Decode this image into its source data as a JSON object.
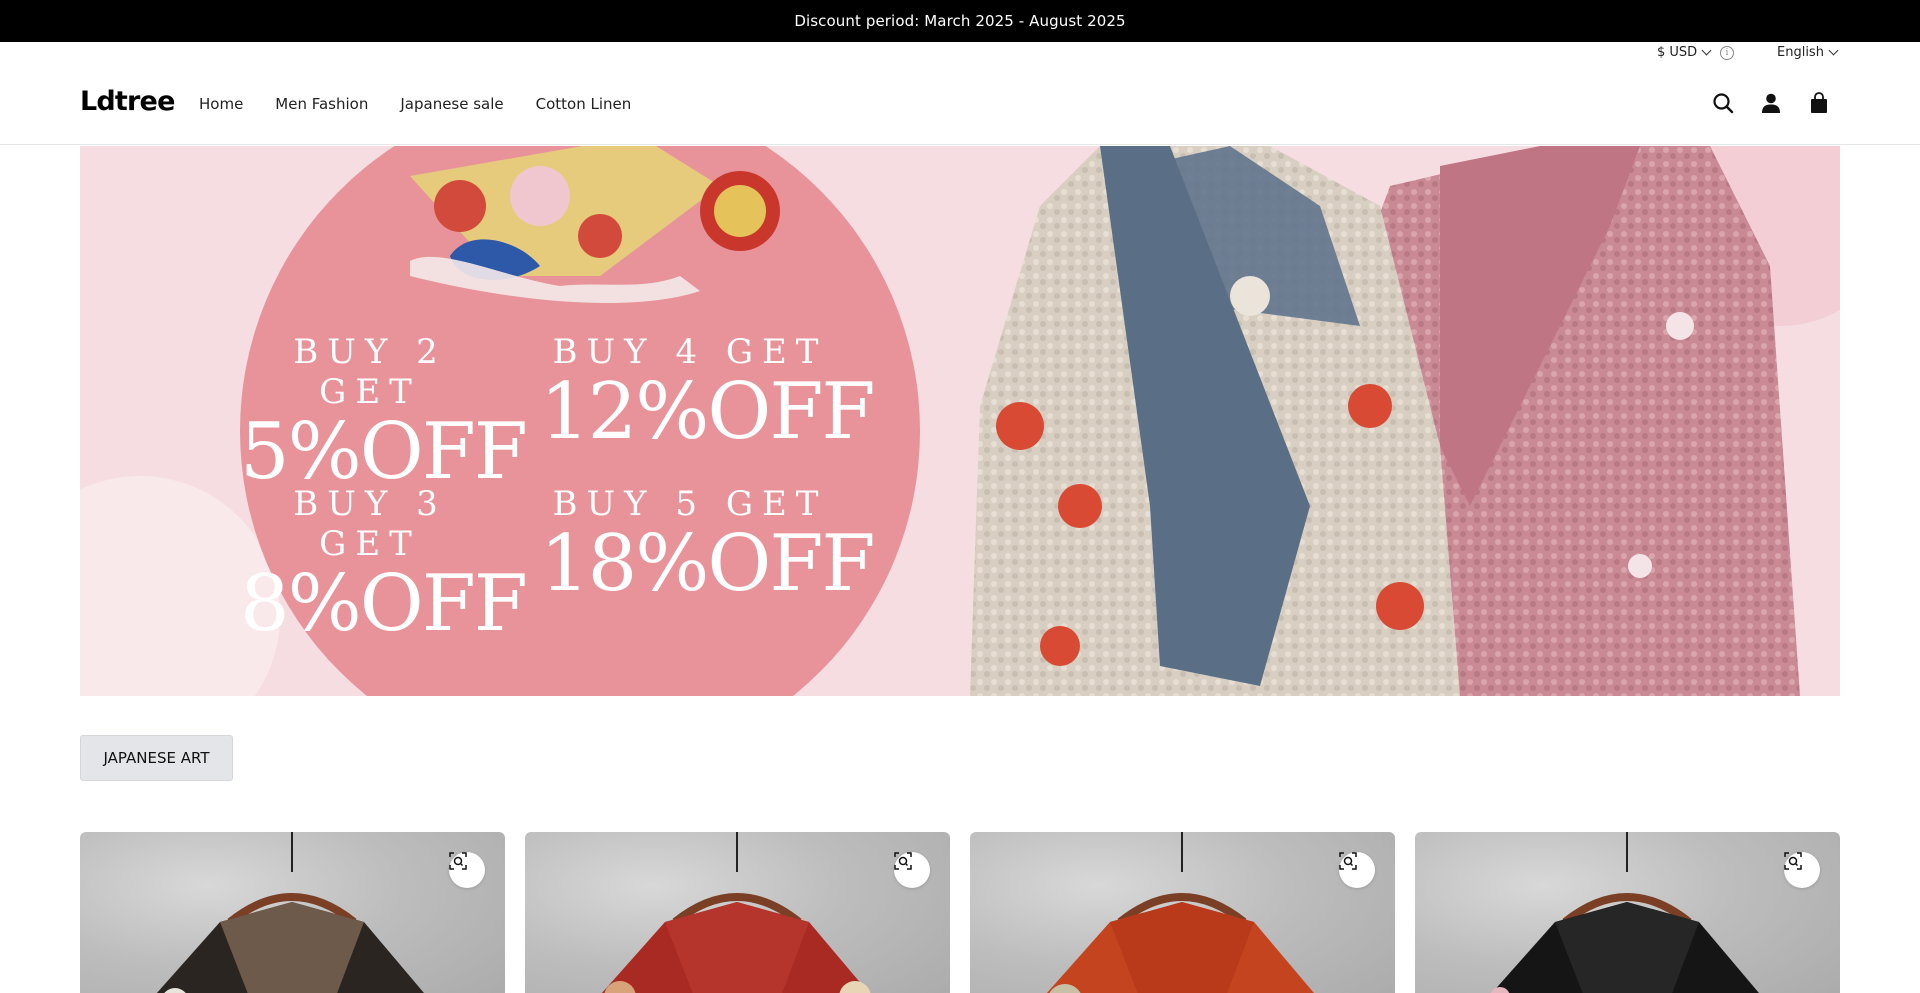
{
  "announcement": "Discount period: March 2025 - August 2025",
  "utility": {
    "currency": "$ USD",
    "language": "English"
  },
  "header": {
    "logo": "Ldtree",
    "nav": [
      "Home",
      "Men Fashion",
      "Japanese sale",
      "Cotton Linen"
    ],
    "icons": [
      "search-icon",
      "account-icon",
      "cart-icon"
    ]
  },
  "hero": {
    "offers": [
      {
        "buy": "BUY 2 GET",
        "off": "5%OFF"
      },
      {
        "buy": "BUY 4 GET",
        "off": "12%OFF"
      },
      {
        "buy": "BUY 3 GET",
        "off": "8%OFF"
      },
      {
        "buy": "BUY 5 GET",
        "off": "18%OFF"
      }
    ]
  },
  "filter": {
    "label": "JAPANESE ART"
  },
  "products": [
    {
      "quick_view_icon": "quick-view-icon",
      "color": "#3a2f2a"
    },
    {
      "quick_view_icon": "quick-view-icon",
      "color": "#a82a22"
    },
    {
      "quick_view_icon": "quick-view-icon",
      "color": "#c4441f"
    },
    {
      "quick_view_icon": "quick-view-icon",
      "color": "#151515"
    }
  ],
  "colors": {
    "announce_bg": "#000000",
    "promo_circle": "#e8939a",
    "button_bg": "#e4e5e8"
  }
}
